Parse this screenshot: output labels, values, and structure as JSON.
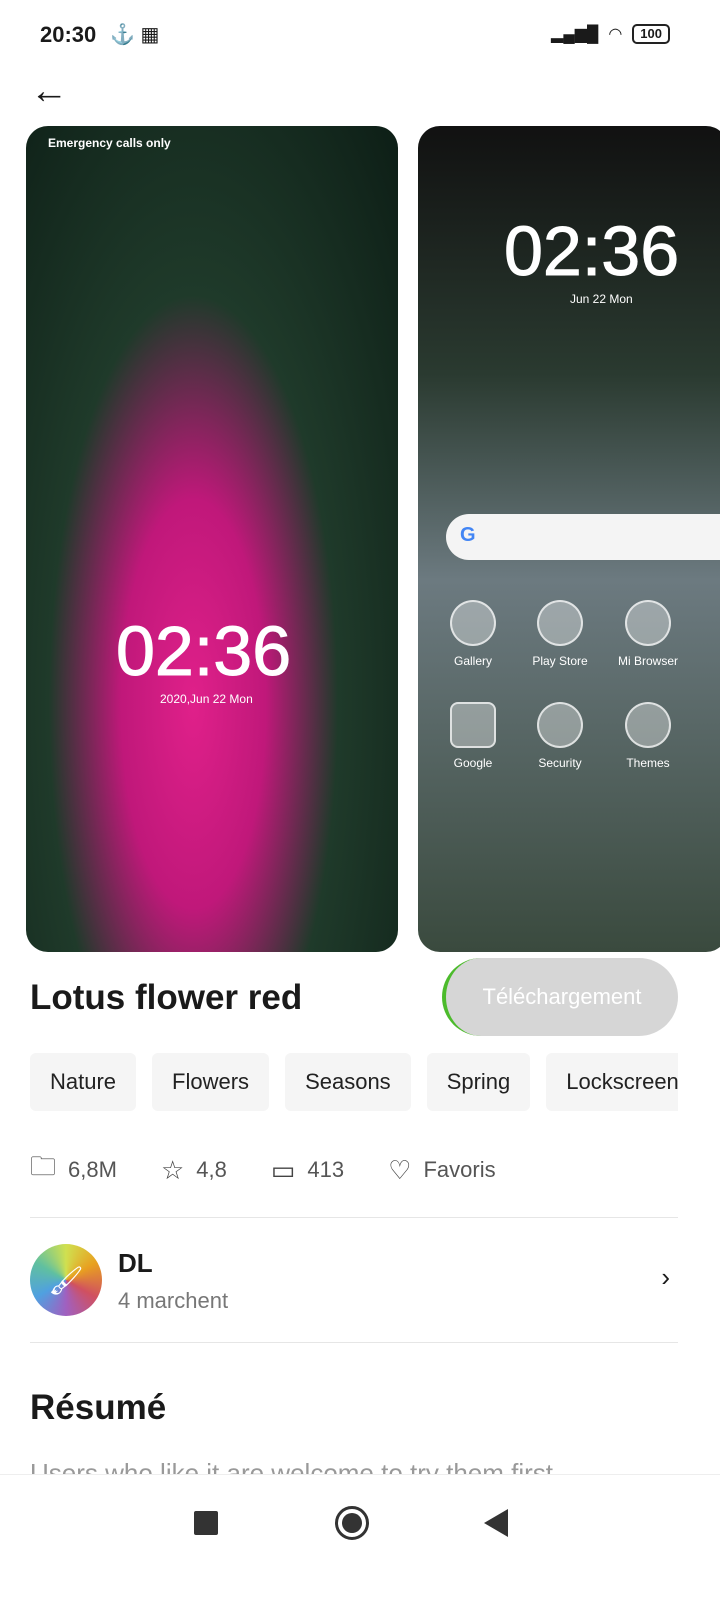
{
  "status_bar": {
    "time": "20:30",
    "battery": "100",
    "left_icons": [
      "download-icon",
      "grid-icon"
    ],
    "right_icons": [
      "signal-icon",
      "wifi-icon",
      "battery-icon"
    ]
  },
  "preview1": {
    "status": "Emergency calls only",
    "clock": "02:36",
    "date": "2020,Jun 22 Mon"
  },
  "preview2": {
    "clock": "02:36",
    "date": "Jun 22 Mon",
    "search": "G",
    "apps": [
      "Gallery",
      "Play Store",
      "Mi Browser",
      "Google",
      "Security",
      "Themes"
    ]
  },
  "theme": {
    "title": "Lotus flower red",
    "download_label": "Téléchargement",
    "accent": "#4cbb2c"
  },
  "tags": [
    "Nature",
    "Flowers",
    "Seasons",
    "Spring",
    "Lockscreen"
  ],
  "stats": {
    "size": "6,8M",
    "rating": "4,8",
    "comments": "413",
    "favorites": "Favoris"
  },
  "author": {
    "name": "DL",
    "subtitle": "4 marchent"
  },
  "summary": {
    "heading": "Résumé",
    "text": "Users who like it are welcome to try them first"
  }
}
